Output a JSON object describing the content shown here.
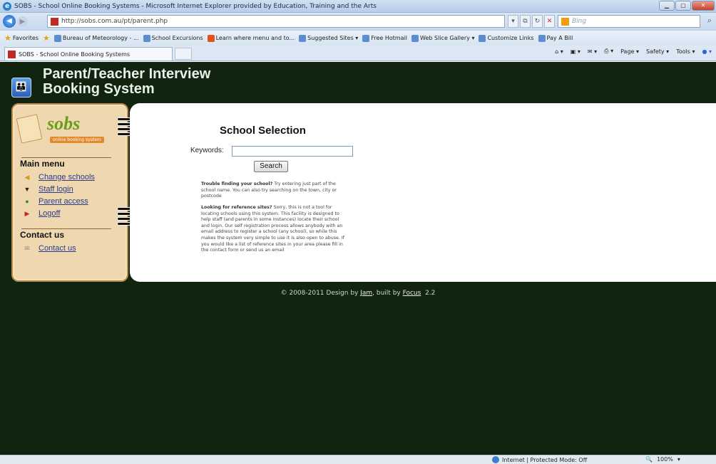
{
  "browser": {
    "window_title": "SOBS - School Online Booking Systems - Microsoft Internet Explorer provided by Education, Training and the Arts",
    "url": "http://sobs.com.au/pt/parent.php",
    "search_placeholder": "Bing",
    "favorites_label": "Favorites",
    "favorites": [
      "Bureau of Meteorology - ...",
      "School Excursions",
      "Learn where menu and to...",
      "Suggested Sites ▾",
      "Free Hotmail",
      "Web Slice Gallery ▾",
      "Customize Links",
      "Pay A Bill"
    ],
    "tab_title": "SOBS - School Online Booking Systems",
    "commands": [
      "Page ▾",
      "Safety ▾",
      "Tools ▾"
    ],
    "status_zone": "Internet | Protected Mode: Off",
    "zoom": "100%"
  },
  "page": {
    "title_line1": "Parent/Teacher Interview",
    "title_line2": "Booking System",
    "logo_word": "sobs",
    "logo_tag": "online booking system"
  },
  "sidebar": {
    "main_menu_title": "Main menu",
    "main_items": [
      {
        "label": "Change schools",
        "icon": "megaphone-icon"
      },
      {
        "label": "Staff login",
        "icon": "graduation-cap-icon"
      },
      {
        "label": "Parent access",
        "icon": "person-icon"
      },
      {
        "label": "Logoff",
        "icon": "logoff-icon"
      }
    ],
    "contact_title": "Contact us",
    "contact_items": [
      {
        "label": "Contact us",
        "icon": "envelope-icon"
      }
    ]
  },
  "main": {
    "heading": "School Selection",
    "keywords_label": "Keywords:",
    "keywords_value": "",
    "search_button": "Search",
    "help1_bold": "Trouble finding your school?",
    "help1_text": " Try entering just part of the school name. You can also try searching on the town, city or postcode",
    "help2_bold": "Looking for reference sites?",
    "help2_text": " Sorry, this is not a tool for locating schools using this system. This facility is designed to help staff (and parents in some instances) locate their school and login. Our self registration process allows anybody with an email address to register a school (any school), so while this makes the system very simple to use it is also open to abuse. If you would like a list of reference sites in your area please fill in the contact form or send us an email"
  },
  "footer": {
    "prefix": "© 2008-2011 Design by ",
    "designer": "Jam",
    "mid": ", built by ",
    "builder": "Focus",
    "version": "2.2"
  }
}
